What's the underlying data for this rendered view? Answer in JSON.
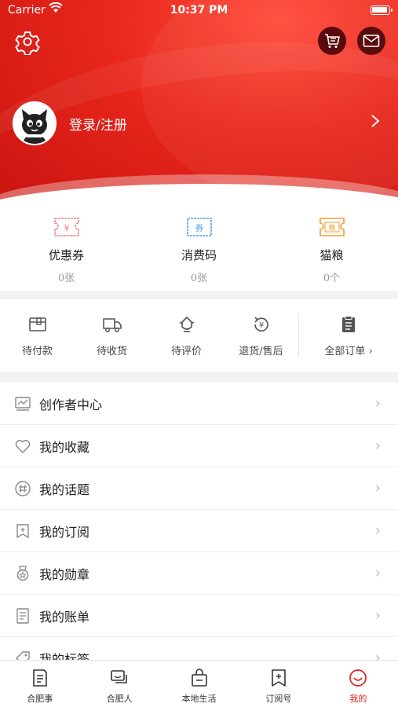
{
  "status_bar": {
    "carrier": "Carrier",
    "time": "10:37 PM"
  },
  "header": {
    "login_text": "登录/注册"
  },
  "wallet": [
    {
      "label": "优惠券",
      "value": "0张",
      "icon": "coupon-icon",
      "icon_text": "¥",
      "color": "#f08080"
    },
    {
      "label": "消费码",
      "value": "0张",
      "icon": "voucher-icon",
      "icon_text": "券",
      "color": "#5aa0e0"
    },
    {
      "label": "猫粮",
      "value": "0个",
      "icon": "cat-food-icon",
      "icon_text": "粮",
      "color": "#f0a030"
    }
  ],
  "orders": {
    "items": [
      {
        "label": "待付款",
        "icon": "wallet-icon"
      },
      {
        "label": "待收货",
        "icon": "truck-icon"
      },
      {
        "label": "待评价",
        "icon": "review-icon"
      },
      {
        "label": "退货/售后",
        "icon": "refund-icon"
      }
    ],
    "all_label": "全部订单 ›"
  },
  "menu": [
    {
      "label": "创作者中心",
      "icon": "creator-chart-icon"
    },
    {
      "label": "我的收藏",
      "icon": "heart-icon"
    },
    {
      "label": "我的话题",
      "icon": "hashtag-icon"
    },
    {
      "label": "我的订阅",
      "icon": "subscribe-icon"
    },
    {
      "label": "我的勋章",
      "icon": "medal-icon"
    },
    {
      "label": "我的账单",
      "icon": "bill-icon"
    },
    {
      "label": "我的标签",
      "icon": "tag-icon"
    }
  ],
  "tabbar": [
    {
      "label": "合肥事",
      "icon": "news-icon",
      "active": false
    },
    {
      "label": "合肥人",
      "icon": "chat-icon",
      "active": false
    },
    {
      "label": "本地生活",
      "icon": "shopping-bag-icon",
      "active": false
    },
    {
      "label": "订阅号",
      "icon": "subscribe-icon",
      "active": false
    },
    {
      "label": "我的",
      "icon": "smile-icon",
      "active": true
    }
  ],
  "colors": {
    "primary_red": "#e02020",
    "header_red": "#e8261c"
  }
}
